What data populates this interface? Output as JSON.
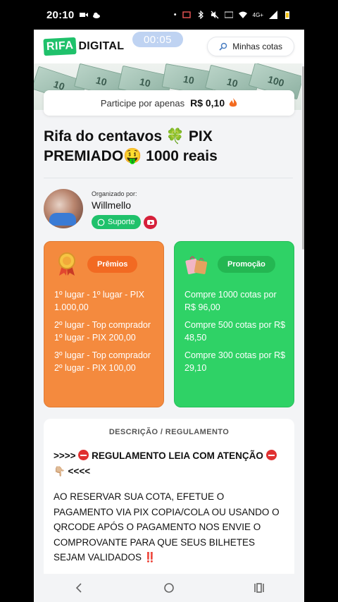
{
  "status_bar": {
    "time": "20:10",
    "network_label": "4G+"
  },
  "header": {
    "logo_part1": "RIFA",
    "logo_part2": "DIGITAL",
    "timer": "00:05",
    "my_tickets_label": "Minhas cotas"
  },
  "banner": {
    "note_values": [
      "10",
      "10",
      "10",
      "10",
      "10",
      "100"
    ]
  },
  "price_strip": {
    "label": "Participe por apenas",
    "value": "R$ 0,10"
  },
  "raffle": {
    "title": "Rifa do centavos 🍀 PIX PREMIADO🤑 1000 reais"
  },
  "organizer": {
    "label": "Organizado por:",
    "name": "Willmello",
    "support_label": "Suporte"
  },
  "prizes": {
    "pill_label": "Prêmios",
    "items": [
      "1º lugar - 1º lugar - PIX 1.000,00",
      "2º lugar - Top comprador 1º lugar - PIX 200,00",
      "3º lugar - Top comprador 2º lugar - PIX 100,00"
    ]
  },
  "promotions": {
    "pill_label": "Promoção",
    "items": [
      "Compre 1000 cotas por R$ 96,00",
      "Compre 500 cotas por R$ 48,50",
      "Compre 300 cotas por R$ 29,10"
    ]
  },
  "description": {
    "heading": "DESCRIÇÃO / REGULAMENTO",
    "line1_prefix": ">>>>",
    "line1_text": "REGULAMENTO LEIA COM ATENÇÃO",
    "line1_suffix": "👇🏼 <<<<",
    "body": "AO RESERVAR SUA COTA, EFETUE O PAGAMENTO VIA PIX COPIA/COLA OU USANDO O QRCODE APÓS O PAGAMENTO NOS ENVIE O COMPROVANTE PARA QUE SEUS BILHETES SEJAM VALIDADOS ‼️"
  },
  "colors": {
    "brand_green": "#1fc16b",
    "prize_orange": "#f48a3e",
    "promo_green": "#2fd266"
  }
}
